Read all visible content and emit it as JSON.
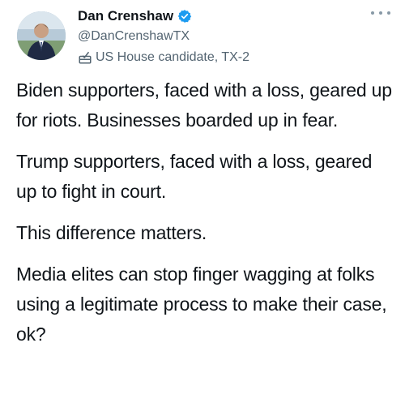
{
  "author": {
    "display_name": "Dan Crenshaw",
    "handle": "@DanCrenshawTX",
    "label": "US House candidate, TX-2",
    "label_icon": "ballot-box-icon",
    "verified_icon": "verified-badge-icon"
  },
  "more_icon": "more-options-icon",
  "tweet": {
    "paragraphs": [
      "Biden supporters, faced with a loss, geared up for riots. Businesses boarded up in fear.",
      "Trump supporters, faced with a loss, geared up to fight in court.",
      "This difference matters.",
      "Media elites can stop finger wagging at folks using a legitimate process to make their case, ok?"
    ]
  },
  "colors": {
    "verified_blue": "#1d9bf0",
    "secondary_text": "#536471",
    "primary_text": "#0f1419"
  }
}
